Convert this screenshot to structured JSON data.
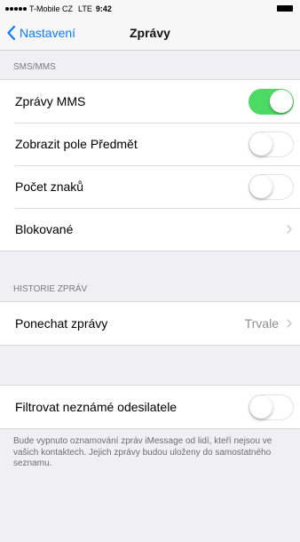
{
  "status_bar": {
    "carrier": "T-Mobile CZ",
    "network": "LTE",
    "time": "9:42"
  },
  "nav": {
    "back_label": "Nastavení",
    "title": "Zprávy",
    "accent_color": "#0a7aff"
  },
  "sections": {
    "sms_mms": {
      "header": "SMS/MMS",
      "rows": [
        {
          "label": "Zprávy MMS",
          "toggle": true
        },
        {
          "label": "Zobrazit pole Předmět",
          "toggle": false
        },
        {
          "label": "Počet znaků",
          "toggle": false
        },
        {
          "label": "Blokované",
          "chevron": true
        }
      ]
    },
    "history": {
      "header": "HISTORIE ZPRÁV",
      "rows": [
        {
          "label": "Ponechat zprávy",
          "value": "Trvale",
          "chevron": true
        }
      ]
    },
    "filter": {
      "rows": [
        {
          "label": "Filtrovat neznámé odesilatele",
          "toggle": false
        }
      ],
      "footer": "Bude vypnuto oznamování zpráv iMessage od lidí, kteří nejsou ve vašich kontaktech. Jejich zprávy budou uloženy do samostatného seznamu."
    }
  },
  "toggle_on_color": "#4cd964"
}
